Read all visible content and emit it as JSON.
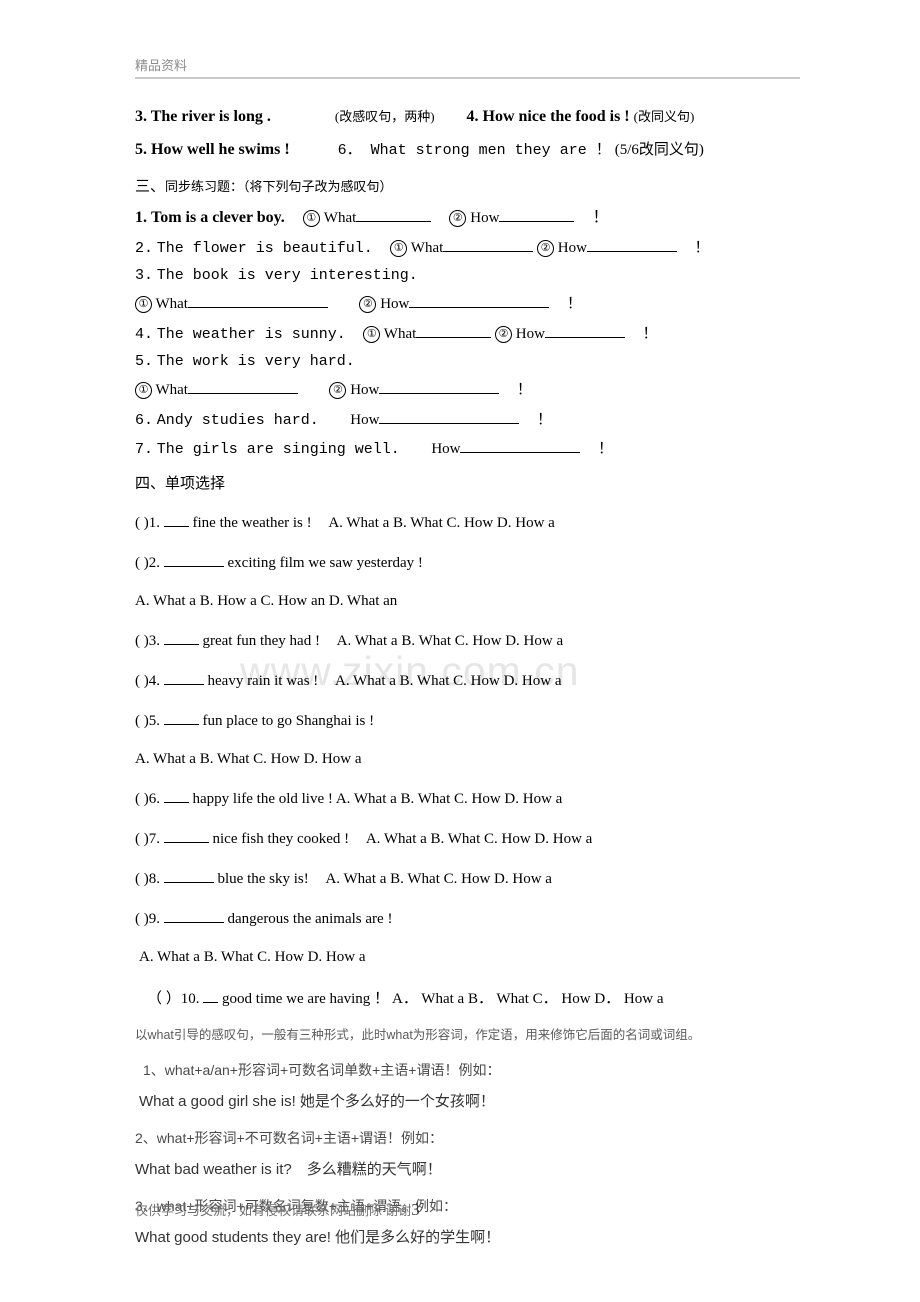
{
  "header": {
    "title": "精品资料"
  },
  "watermark": {
    "text": "www.zixin.com.cn"
  },
  "top_exercises": {
    "line1": {
      "q3_text": "3. The river is long .",
      "q3_hint": "(改感叹句，两种)",
      "q4_text": "4. How nice the food is !",
      "q4_hint": "(改同义句)"
    },
    "line2": {
      "q5_text": "5. How well he swims !",
      "q6_text": "6． What strong men they are ！",
      "q6_hint": "(5/6改同义句)"
    }
  },
  "section3": {
    "heading_num": "三、",
    "heading_title": "同步练习题：",
    "heading_hint": "（将下列句子改为感叹句）",
    "items": [
      {
        "number": "1.",
        "sentence": "Tom is a clever boy.",
        "opt1_marker": "①",
        "opt1_word": "What",
        "opt2_marker": "②",
        "opt2_word": "How",
        "end": "！"
      },
      {
        "number": "2.",
        "sentence": "The flower is beautiful.",
        "opt1_marker": "①",
        "opt1_word": "What",
        "opt2_marker": "②",
        "opt2_word": "How",
        "end": "！"
      },
      {
        "number": "3.",
        "sentence": "The book is very interesting.",
        "opt1_marker": "①",
        "opt1_word": "What",
        "opt2_marker": "②",
        "opt2_word": "How",
        "end": "！"
      },
      {
        "number": "4.",
        "sentence": "The weather is sunny.",
        "opt1_marker": "①",
        "opt1_word": "What",
        "opt2_marker": "②",
        "opt2_word": "How",
        "end": "！"
      },
      {
        "number": "5.",
        "sentence": "The work is very hard.",
        "opt1_marker": "①",
        "opt1_word": "What",
        "opt2_marker": "②",
        "opt2_word": "How",
        "end": "！"
      },
      {
        "number": "6.",
        "sentence": "Andy studies hard.",
        "opt1_word": "How",
        "end": "！"
      },
      {
        "number": "7.",
        "sentence": "The girls are singing well.",
        "opt1_word": "How",
        "end": "！"
      }
    ]
  },
  "section4": {
    "heading_num": "四、",
    "heading_title": "单项选择",
    "questions": [
      {
        "marker": "(  )1.",
        "stem": "fine the weather is !",
        "options_inline": "A. What a   B. What  C. How  D. How a",
        "options_below": null
      },
      {
        "marker": "(  )2.",
        "stem": "exciting film we saw yesterday !",
        "options_inline": null,
        "options_below": "A. What a     B. How a     C. How an     D. What an"
      },
      {
        "marker": "(  )3.",
        "stem": "great fun they had !",
        "options_inline": "A. What a    B. What    C. How   D. How a",
        "options_below": null
      },
      {
        "marker": "(  )4.",
        "stem": "heavy rain it was !",
        "options_inline": "A. What a  B. What   C. How  D. How a",
        "options_below": null
      },
      {
        "marker": "(  )5.",
        "stem": "fun place to go Shanghai is !",
        "options_inline": null,
        "options_below": "A. What a  B. What      C. How       D. How a"
      },
      {
        "marker": "(  )6.",
        "stem": "happy life the old live !",
        "options_inline": "A. What a  B. What   C. How   D. How a",
        "options_below": null
      },
      {
        "marker": "(  )7.",
        "stem": "nice fish they cooked !",
        "options_inline": "A. What a  B. What   C. How     D. How a",
        "options_below": null
      },
      {
        "marker": "(  )8.",
        "stem": "blue the sky is!",
        "options_inline": "A. What a    B. What   C. How   D. How a",
        "options_below": null
      },
      {
        "marker": "(  )9.",
        "stem": "dangerous the animals are !",
        "options_inline": null,
        "options_below": "A. What a    B. What   C. How   D. How a"
      },
      {
        "marker": "（ ）10.",
        "stem": "good time we are having ！",
        "options_inline": "A． What a  B． What C． How D． How a",
        "options_below": null
      }
    ]
  },
  "notes": {
    "intro": "以what引导的感叹句，一般有三种形式，此时what为形容词，作定语，用来修饰它后面的名词或词组。",
    "rules": [
      {
        "rule": "1、what+a/an+形容词+可数名词单数+主语+谓语！例如：",
        "example": "What a good girl she is!  她是个多么好的一个女孩啊！"
      },
      {
        "rule": "2、what+形容词+不可数名词+主语+谓语！例如：",
        "example": "What bad weather is it?　多么糟糕的天气啊！"
      },
      {
        "rule": "3、what+形容词+可数名词复数+主语+谓语。例如：",
        "example": "What good students they are!  他们是多么好的学生啊！"
      }
    ]
  },
  "footer": {
    "text": "仅供学习与交流，如有侵权请联系网站删除 谢谢",
    "page_number": "3"
  }
}
